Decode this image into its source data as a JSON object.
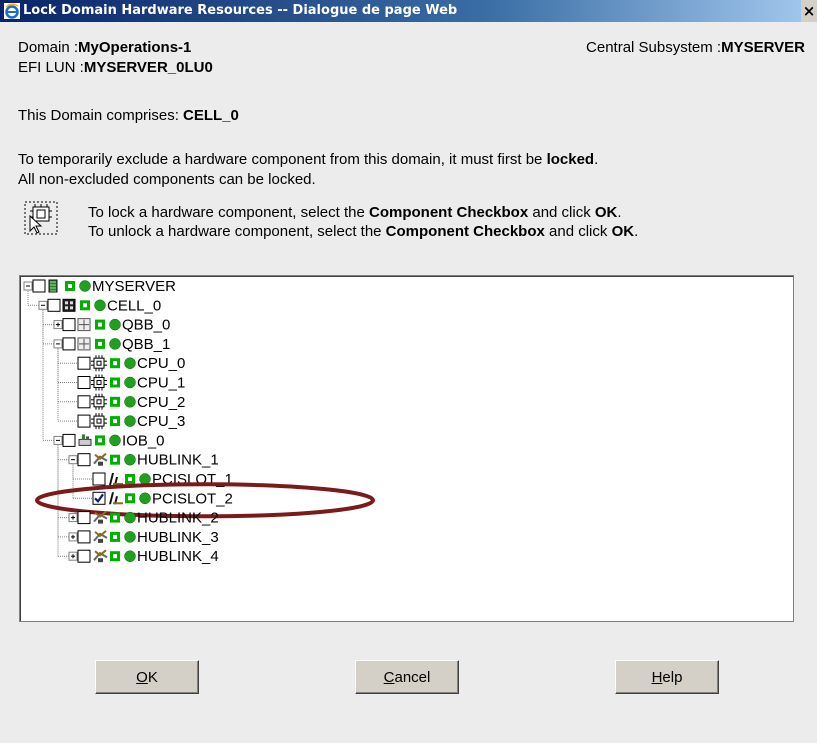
{
  "window": {
    "title": "Lock Domain Hardware Resources -- Dialogue de page Web",
    "close_glyph": "×"
  },
  "header": {
    "domain_label": "Domain :",
    "domain_value": "MyOperations-1",
    "efi_label": "EFI LUN :",
    "efi_value": "MYSERVER_0LU0",
    "central_label": "Central Subsystem :",
    "central_value": "MYSERVER"
  },
  "comprises": {
    "label": "This Domain comprises: ",
    "value": "CELL_0"
  },
  "info": {
    "line1_pre": "To temporarily exclude a hardware component from this domain, it must first be ",
    "line1_bold": "locked",
    "line1_post": ".",
    "line2": "All non-excluded components can be locked."
  },
  "instructions": {
    "lock_pre": "To lock a hardware component, select the ",
    "unlock_pre": "To unlock a hardware component, select the ",
    "checkbox_term": "Component Checkbox",
    "mid": " and click ",
    "ok_term": "OK",
    "end": "."
  },
  "tree": [
    {
      "label": "MYSERVER",
      "type": "server",
      "expander": "minus",
      "checked": false
    },
    {
      "label": "CELL_0",
      "type": "cell",
      "expander": "minus",
      "checked": false
    },
    {
      "label": "QBB_0",
      "type": "qbb",
      "expander": "plus",
      "checked": false
    },
    {
      "label": "QBB_1",
      "type": "qbb",
      "expander": "minus",
      "checked": false
    },
    {
      "label": "CPU_0",
      "type": "cpu",
      "expander": "none",
      "checked": false
    },
    {
      "label": "CPU_1",
      "type": "cpu",
      "expander": "none",
      "checked": false
    },
    {
      "label": "CPU_2",
      "type": "cpu",
      "expander": "none",
      "checked": false
    },
    {
      "label": "CPU_3",
      "type": "cpu",
      "expander": "none",
      "checked": false
    },
    {
      "label": "IOB_0",
      "type": "iob",
      "expander": "minus",
      "checked": false
    },
    {
      "label": "HUBLINK_1",
      "type": "hublink",
      "expander": "minus",
      "checked": false
    },
    {
      "label": "PCISLOT_1",
      "type": "pcislot",
      "expander": "none",
      "checked": false
    },
    {
      "label": "PCISLOT_2",
      "type": "pcislot",
      "expander": "none",
      "checked": true,
      "highlighted": true
    },
    {
      "label": "HUBLINK_2",
      "type": "hublink",
      "expander": "plus",
      "checked": false
    },
    {
      "label": "HUBLINK_3",
      "type": "hublink",
      "expander": "plus",
      "checked": false
    },
    {
      "label": "HUBLINK_4",
      "type": "hublink",
      "expander": "plus",
      "checked": false
    }
  ],
  "buttons": {
    "ok": {
      "mnemonic": "O",
      "rest": "K"
    },
    "cancel": {
      "mnemonic": "C",
      "rest": "ancel"
    },
    "help": {
      "mnemonic": "H",
      "rest": "elp"
    }
  },
  "colors": {
    "status_green": "#1fa01f",
    "lock_green": "#00b000",
    "highlight": "#7a1a1a"
  }
}
